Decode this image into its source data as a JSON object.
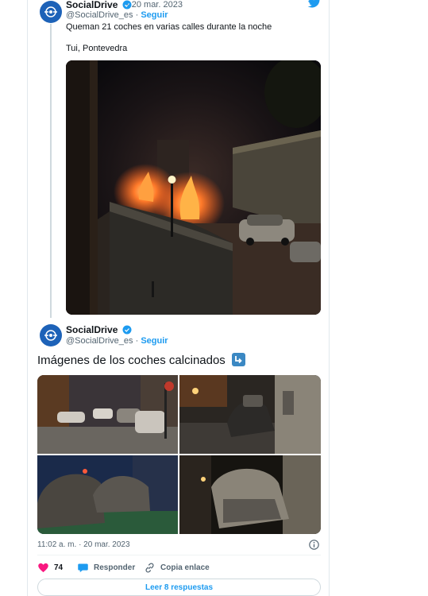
{
  "tweet1": {
    "name": "SocialDrive",
    "date": "20 mar. 2023",
    "handle": "@SocialDrive_es",
    "follow": "Seguir",
    "text_line1": "Queman 21 coches en varias calles durante la noche",
    "text_line2": "Tui, Pontevedra"
  },
  "tweet2": {
    "name": "SocialDrive",
    "handle": "@SocialDrive_es",
    "follow": "Seguir",
    "text": "Imágenes de los coches calcinados",
    "timestamp": "11:02 a. m. · 20 mar. 2023",
    "actions": {
      "likes": "74",
      "reply": "Responder",
      "copy": "Copia enlace"
    },
    "read_replies": "Leer 8 respuestas"
  },
  "colors": {
    "accent": "#1d9bf0",
    "like": "#f91880",
    "avatar": "#1d62b8",
    "muted": "#536471"
  },
  "icons": [
    "twitter-bird-icon",
    "verified-badge-icon",
    "return-arrow-emoji",
    "info-icon",
    "heart-icon",
    "reply-bubble-icon",
    "link-icon"
  ]
}
